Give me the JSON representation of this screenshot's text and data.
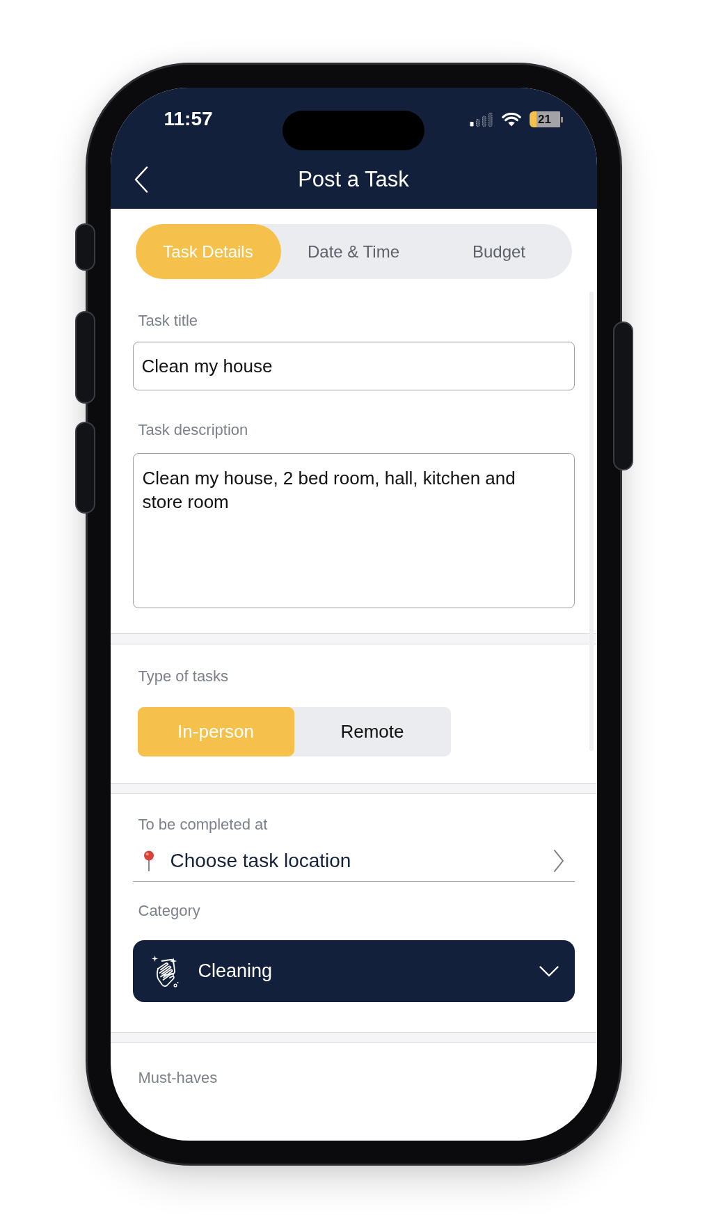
{
  "status_bar": {
    "time": "11:57",
    "battery": "21"
  },
  "header": {
    "title": "Post a Task"
  },
  "tabs": [
    {
      "label": "Task Details",
      "selected": true
    },
    {
      "label": "Date & Time",
      "selected": false
    },
    {
      "label": "Budget",
      "selected": false
    }
  ],
  "task_title": {
    "label": "Task title",
    "value": "Clean my house"
  },
  "task_description": {
    "label": "Task description",
    "value": "Clean my house, 2 bed room, hall, kitchen and store room"
  },
  "task_type": {
    "label": "Type of tasks",
    "options": [
      {
        "label": "In-person",
        "selected": true
      },
      {
        "label": "Remote",
        "selected": false
      }
    ]
  },
  "location": {
    "label": "To be completed at",
    "action": "Choose task location"
  },
  "category": {
    "label": "Category",
    "value": "Cleaning"
  },
  "must_haves": {
    "label": "Must-haves"
  }
}
